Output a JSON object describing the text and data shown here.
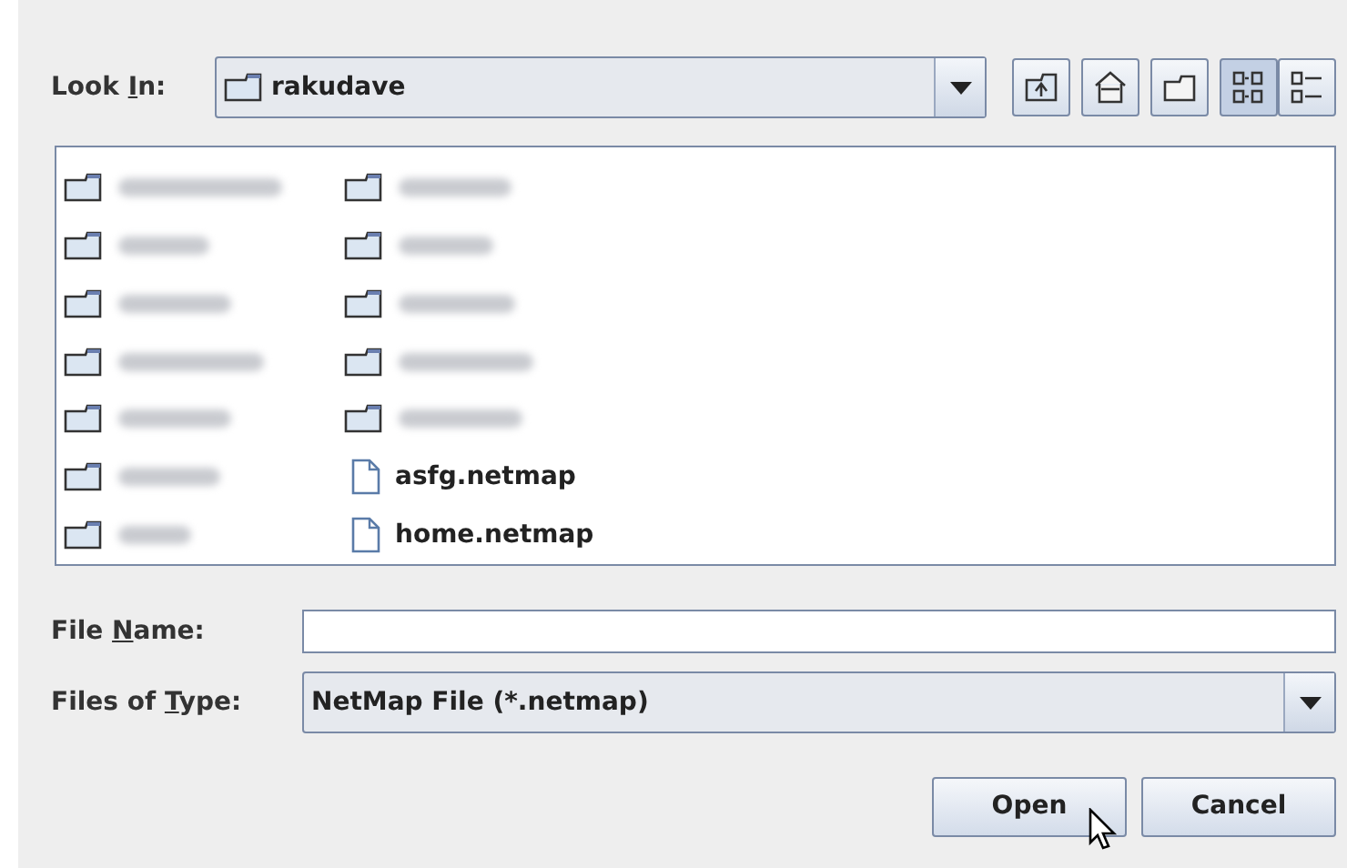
{
  "look_in": {
    "label": {
      "before": "Look ",
      "key": "I",
      "after": "n:"
    },
    "value": "rakudave"
  },
  "toolbar": [
    {
      "kind": "up",
      "selected": false
    },
    {
      "kind": "home",
      "selected": false
    },
    {
      "kind": "new-folder",
      "selected": false
    },
    {
      "kind": "list",
      "selected": true
    },
    {
      "kind": "details",
      "selected": false
    }
  ],
  "files": [
    {
      "kind": "folder"
    },
    {
      "kind": "folder"
    },
    {
      "kind": "folder"
    },
    {
      "kind": "folder"
    },
    {
      "kind": "folder"
    },
    {
      "kind": "folder"
    },
    {
      "kind": "folder"
    },
    {
      "kind": "folder"
    },
    {
      "kind": "folder"
    },
    {
      "kind": "folder"
    },
    {
      "kind": "folder"
    },
    {
      "kind": "folder"
    },
    {
      "kind": "file",
      "name": "asfg.netmap"
    },
    {
      "kind": "file",
      "name": "home.netmap"
    }
  ],
  "file_name": {
    "label": {
      "before": "File ",
      "key": "N",
      "after": "ame:"
    }
  },
  "files_of_type": {
    "label": {
      "before": "Files of ",
      "key": "T",
      "after": "ype:"
    },
    "value": "NetMap File (*.netmap)"
  },
  "buttons": [
    "Open",
    "Cancel"
  ]
}
